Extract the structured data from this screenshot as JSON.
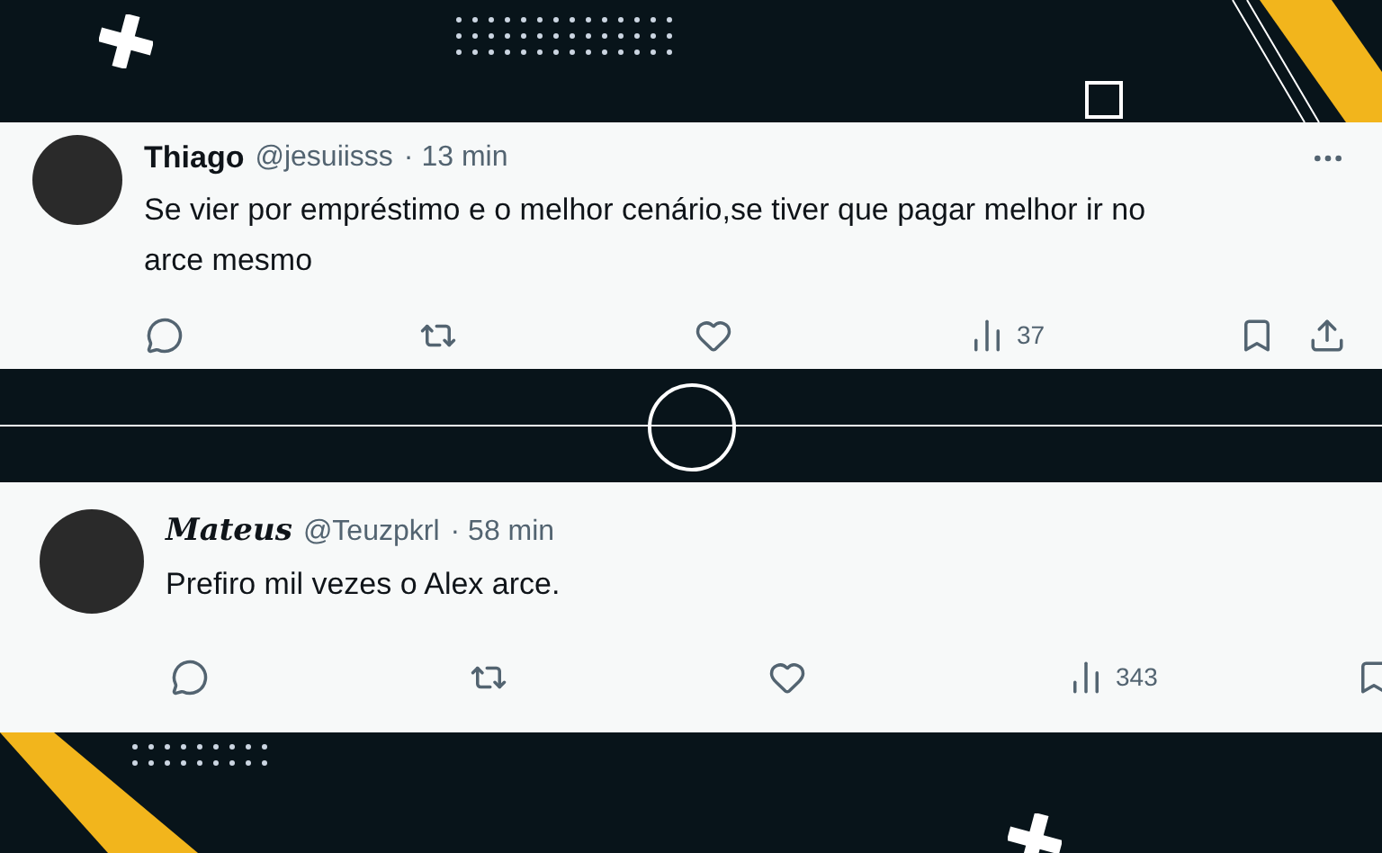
{
  "tweets": [
    {
      "name": "Thiago",
      "kind": "plain",
      "handle": "@jesuiisss",
      "time": "· 13 min",
      "text": "Se vier por empréstimo e o melhor cenário,se tiver que pagar melhor ir no arce mesmo",
      "views": "37"
    },
    {
      "name": "Mateus",
      "kind": "styled",
      "handle": "@Teuzpkrl",
      "time": "· 58 min",
      "text": "Prefiro mil vezes o Alex arce.",
      "views": "343"
    }
  ]
}
